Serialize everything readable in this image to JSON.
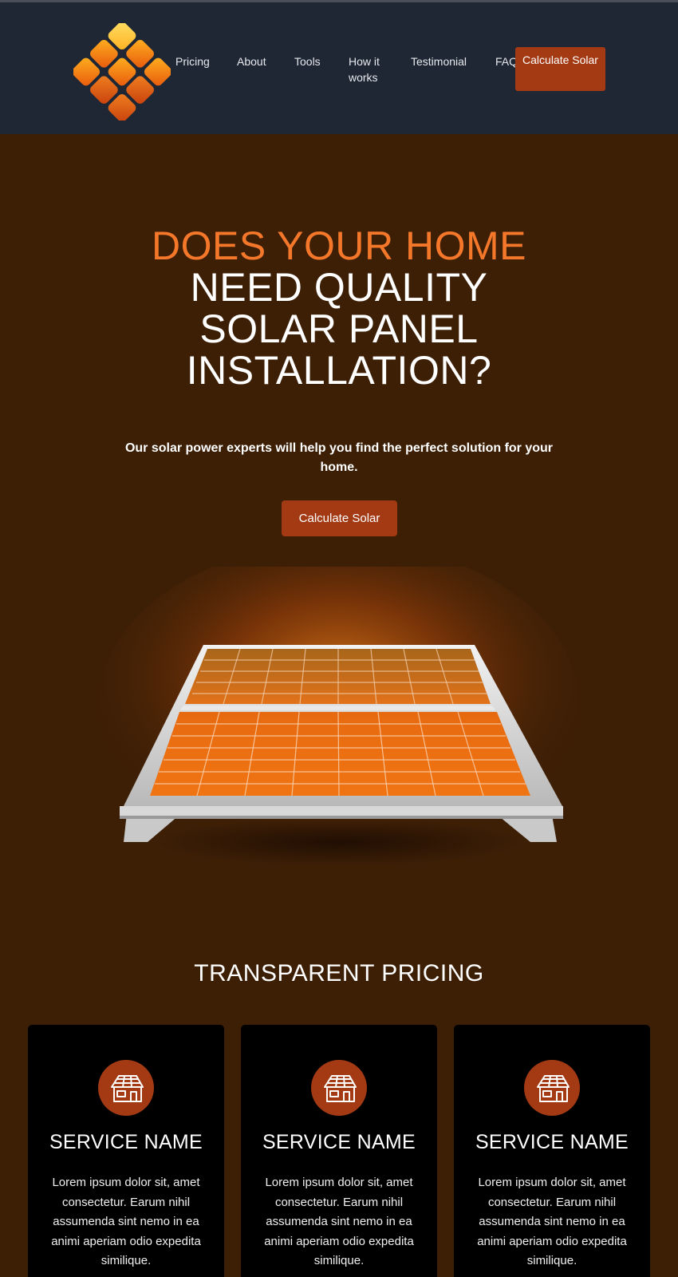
{
  "nav": {
    "items": [
      {
        "label": "Pricing"
      },
      {
        "label": "About"
      },
      {
        "label": "Tools"
      },
      {
        "label": "How it works"
      },
      {
        "label": "Testimonial"
      },
      {
        "label": "FAQ"
      }
    ],
    "cta_label": "Calculate Solar"
  },
  "hero": {
    "title_accent": "DOES YOUR HOME",
    "title_rest": "NEED QUALITY SOLAR PANEL INSTALLATION?",
    "subtitle": "Our solar power experts will help you find the perfect solution for your home.",
    "cta_label": "Calculate Solar"
  },
  "pricing": {
    "title": "TRANSPARENT PRICING",
    "cards": [
      {
        "icon": "house-solar-icon",
        "name": "SERVICE NAME",
        "text": "Lorem ipsum dolor sit, amet consectetur. Earum nihil assumenda sint nemo in ea animi aperiam odio expedita similique."
      },
      {
        "icon": "house-solar-icon",
        "name": "SERVICE NAME",
        "text": "Lorem ipsum dolor sit, amet consectetur. Earum nihil assumenda sint nemo in ea animi aperiam odio expedita similique."
      },
      {
        "icon": "house-solar-icon",
        "name": "SERVICE NAME",
        "text": "Lorem ipsum dolor sit, amet consectetur. Earum nihil assumenda sint nemo in ea animi aperiam odio expedita similique."
      }
    ]
  },
  "colors": {
    "header_bg": "#1f2735",
    "page_bg": "#3d1f06",
    "accent_orange": "#f5782a",
    "button_red": "#a33a14",
    "card_bg": "#000000"
  }
}
